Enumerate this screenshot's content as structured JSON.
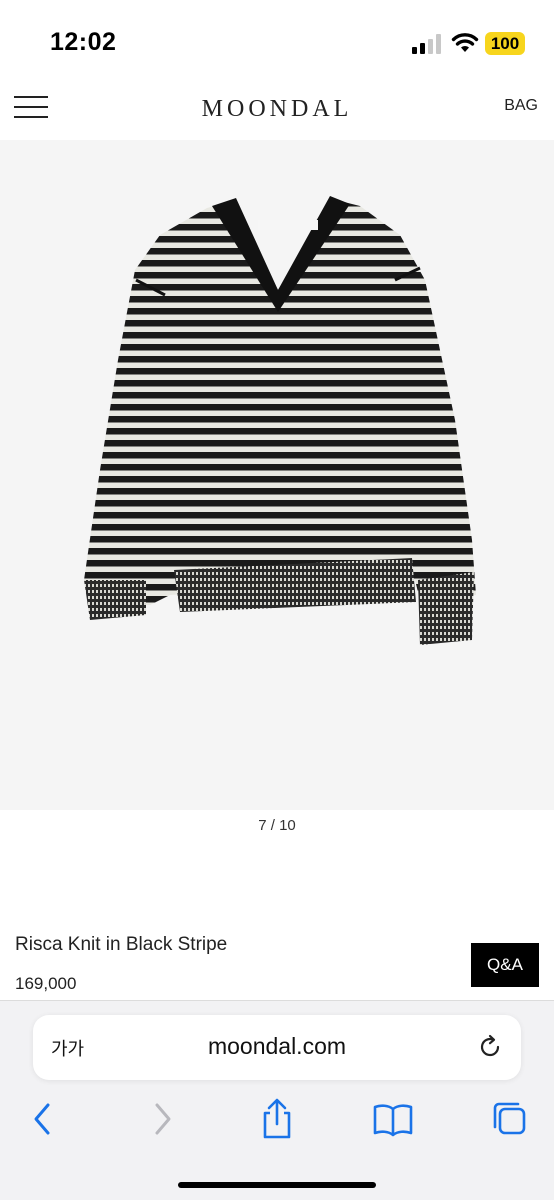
{
  "status": {
    "time": "12:02",
    "battery": "100"
  },
  "header": {
    "brand": "MOONDAL",
    "bag_label": "BAG"
  },
  "product": {
    "image_counter": "7 / 10",
    "name": "Risca Knit in Black Stripe",
    "price": "169,000",
    "qa_label": "Q&A"
  },
  "browser": {
    "text_size_label": "가가",
    "url": "moondal.com"
  },
  "colors": {
    "accent": "#1a73e8",
    "battery": "#f7d51d",
    "disabled": "#b8b8bd"
  }
}
